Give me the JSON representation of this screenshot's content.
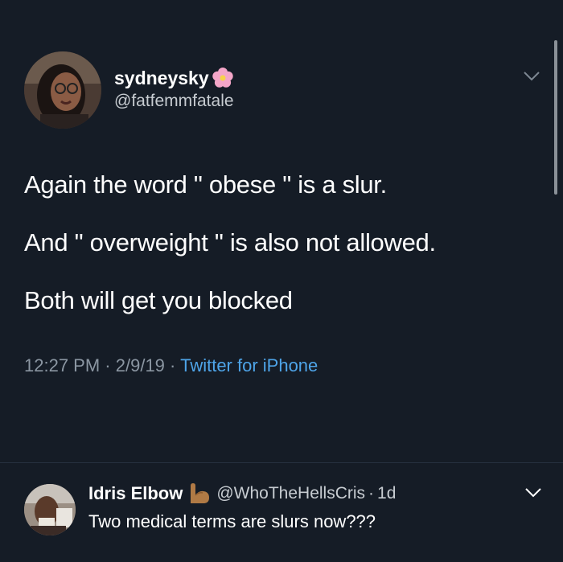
{
  "tweet": {
    "display_name": "sydneysky",
    "name_emoji": "cherry-blossom-icon",
    "handle": "@fatfemmfatale",
    "lines": [
      "Again the word \" obese \" is a slur.",
      "And \" overweight \" is also not allowed.",
      "Both will get you blocked"
    ],
    "time": "12:27 PM",
    "date": "2/9/19",
    "separator": "·",
    "source": "Twitter for iPhone"
  },
  "reply": {
    "display_name": "Idris Elbow",
    "name_emoji": "flexed-biceps-icon",
    "handle": "@WhoTheHellsCris",
    "time_sep": "·",
    "time": "1d",
    "text": "Two medical terms are slurs now???"
  },
  "colors": {
    "background": "#151c26",
    "link": "#4ea4e8",
    "muted": "#8b96a2"
  }
}
